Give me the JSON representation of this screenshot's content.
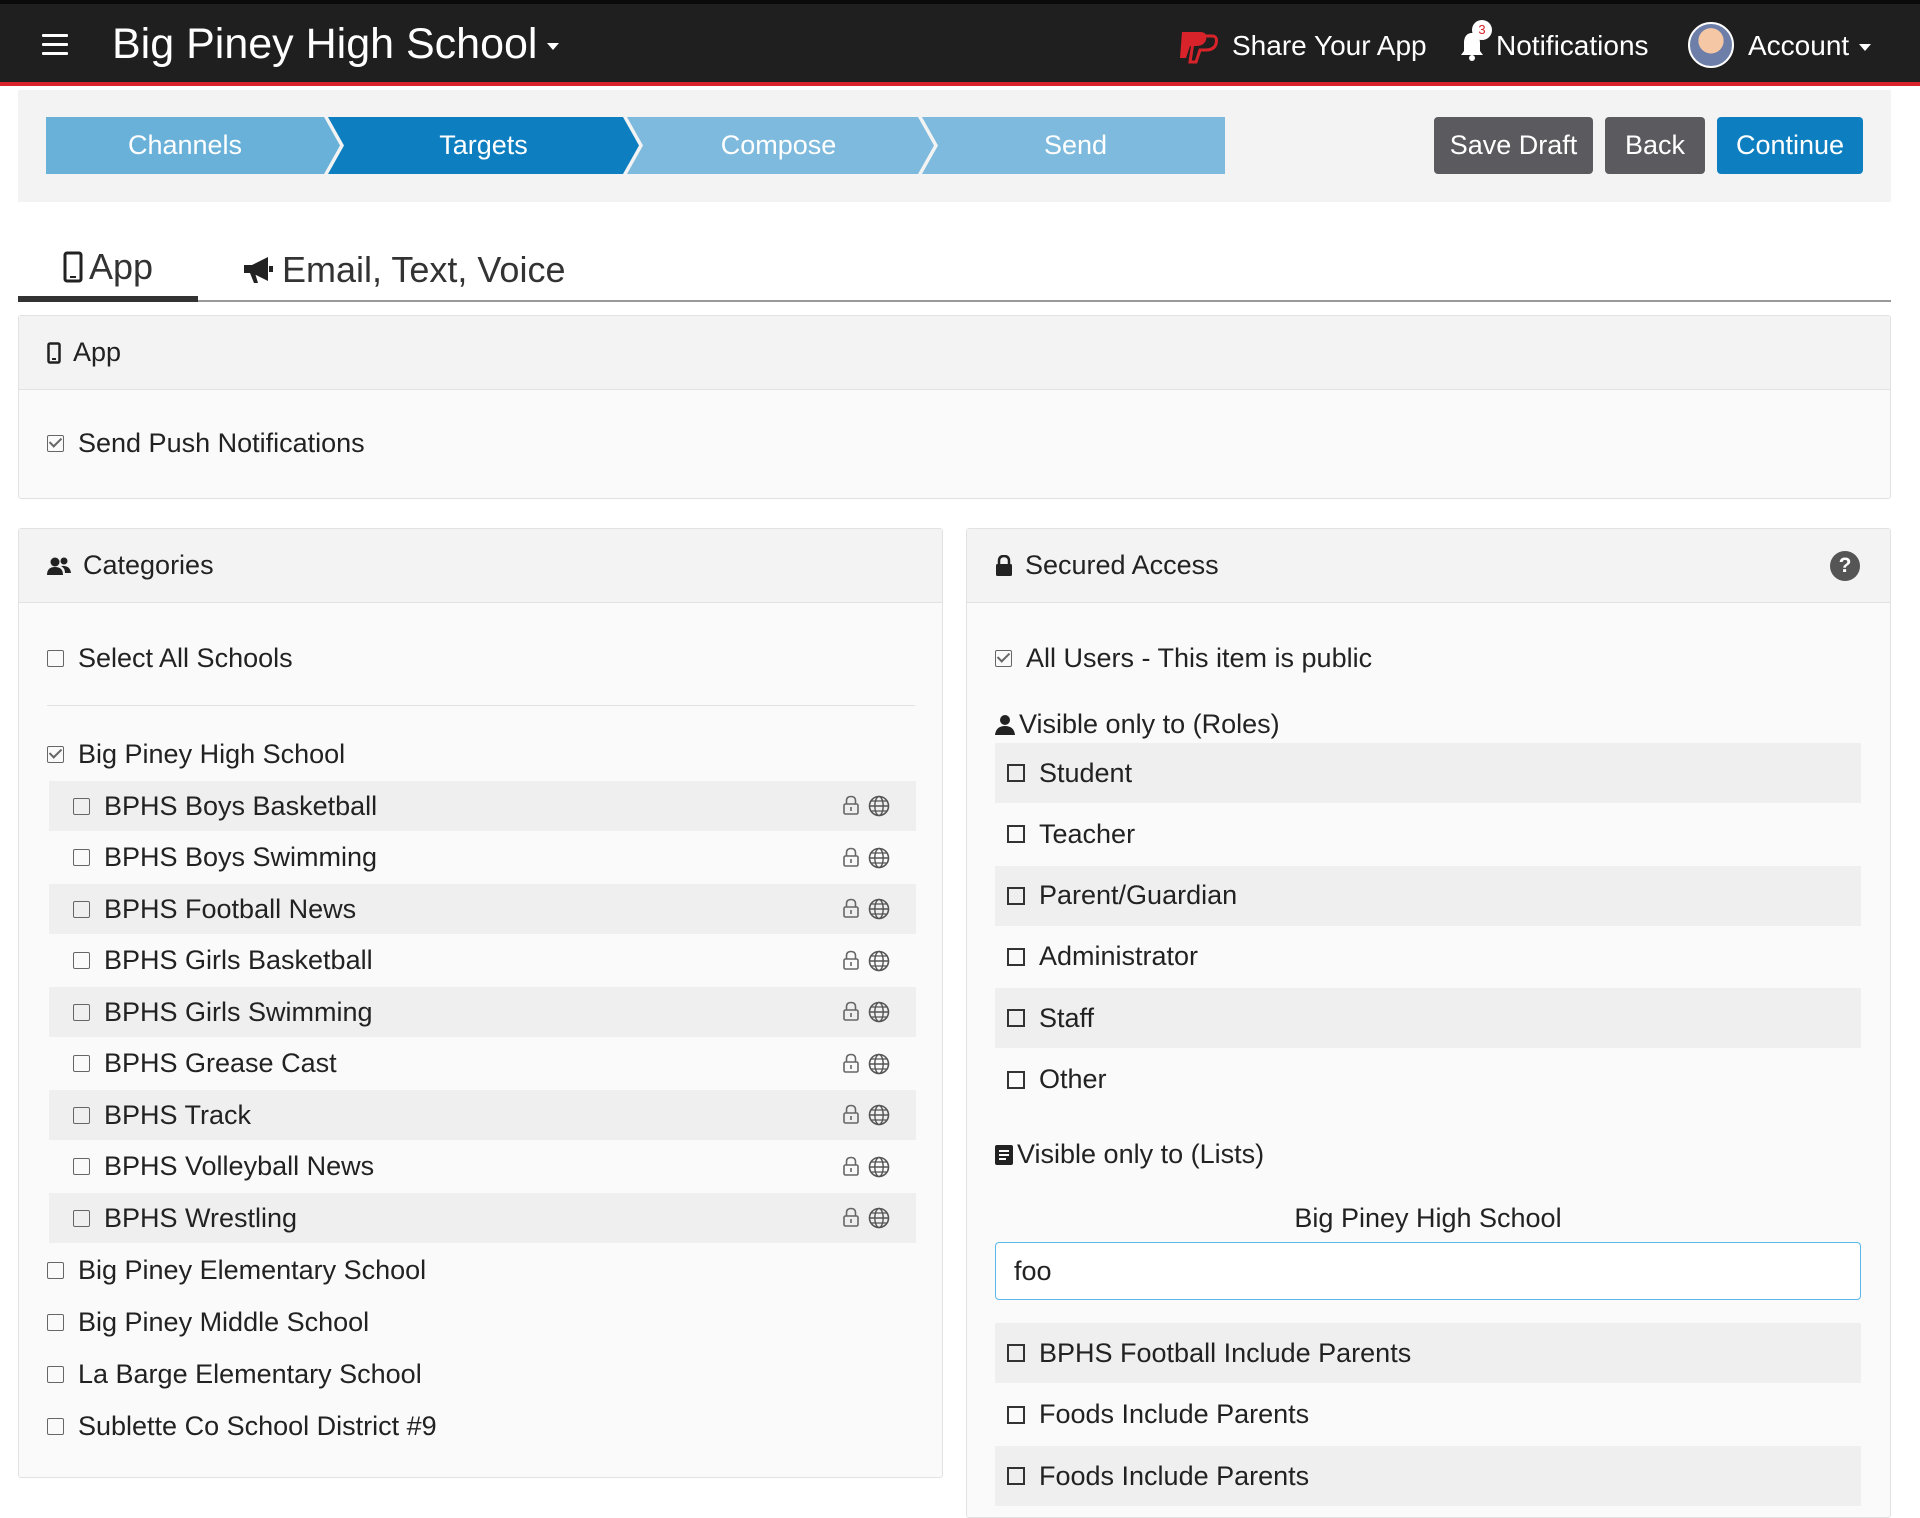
{
  "navbar": {
    "title": "Big Piney High School",
    "share_label": "Share Your App",
    "notifications_label": "Notifications",
    "notification_count": "3",
    "account_label": "Account"
  },
  "wizard": {
    "steps": [
      {
        "label": "Channels",
        "state": "complete"
      },
      {
        "label": "Targets",
        "state": "active"
      },
      {
        "label": "Compose",
        "state": "pending"
      },
      {
        "label": "Send",
        "state": "pending"
      }
    ],
    "save_draft_label": "Save Draft",
    "back_label": "Back",
    "continue_label": "Continue"
  },
  "tabs": [
    {
      "label": "App",
      "icon": "mobile-icon",
      "active": true
    },
    {
      "label": "Email, Text, Voice",
      "icon": "megaphone-icon",
      "active": false
    }
  ],
  "app_panel": {
    "title": "App",
    "push_label": "Send Push Notifications",
    "push_checked": true
  },
  "categories": {
    "title": "Categories",
    "select_all_label": "Select All Schools",
    "schools": [
      {
        "label": "Big Piney High School",
        "checked": true
      },
      {
        "label": "Big Piney Elementary School",
        "checked": false
      },
      {
        "label": "Big Piney Middle School",
        "checked": false
      },
      {
        "label": "La Barge Elementary School",
        "checked": false
      },
      {
        "label": "Sublette Co School District #9",
        "checked": false
      }
    ],
    "items": [
      "BPHS Boys Basketball",
      "BPHS Boys Swimming",
      "BPHS Football News",
      "BPHS Girls Basketball",
      "BPHS Girls Swimming",
      "BPHS Grease Cast",
      "BPHS Track",
      "BPHS Volleyball News",
      "BPHS Wrestling"
    ]
  },
  "secured": {
    "title": "Secured Access",
    "all_users_label": "All Users - This item is public",
    "all_users_checked": true,
    "roles_heading": "Visible only to (Roles)",
    "roles": [
      "Student",
      "Teacher",
      "Parent/Guardian",
      "Administrator",
      "Staff",
      "Other"
    ],
    "lists_heading": "Visible only to (Lists)",
    "school_label": "Big Piney High School",
    "search_value": "foo",
    "lists": [
      "BPHS Football Include Parents",
      "Foods Include Parents",
      "Foods Include Parents"
    ]
  },
  "colors": {
    "nav_bg": "#1f1f1f",
    "nav_accent": "#d8232a",
    "step_complete": "#69b1d9",
    "step_active": "#0d7fc0",
    "step_pending": "#7dbadd",
    "btn_gray": "#5b5b5f",
    "btn_blue": "#0d7fc0"
  }
}
